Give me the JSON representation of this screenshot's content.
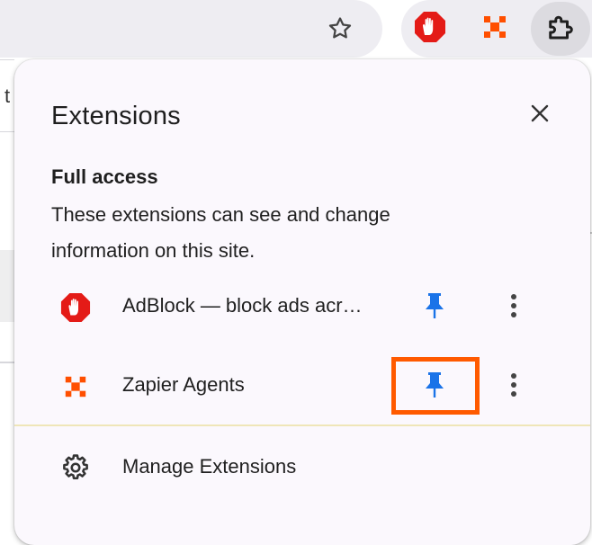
{
  "toolbar": {
    "bookmark_icon": "star-icon",
    "extension_buttons": [
      "adblock-icon",
      "zapier-icon"
    ],
    "extensions_menu_icon": "puzzle-icon"
  },
  "background": {
    "partial_text": "t"
  },
  "popup": {
    "title": "Extensions",
    "close_icon": "close-icon",
    "section": {
      "heading": "Full access",
      "description": "These extensions can see and change information on this site."
    },
    "extensions": [
      {
        "name": "AdBlock — block ads acr…",
        "icon": "adblock-icon",
        "pinned": true,
        "pin_color": "#1a73e8"
      },
      {
        "name": "Zapier Agents",
        "icon": "zapier-icon",
        "pinned": true,
        "pin_color": "#1a73e8"
      }
    ],
    "manage": {
      "label": "Manage Extensions",
      "icon": "gear-icon"
    }
  },
  "colors": {
    "adblock_red": "#e41b17",
    "zapier_orange": "#ff4f00",
    "highlight_orange": "#ff5a00",
    "pin_blue": "#1a73e8"
  }
}
